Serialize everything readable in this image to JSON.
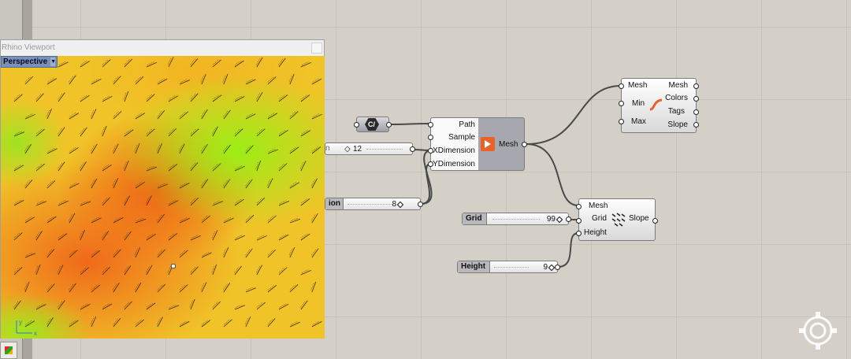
{
  "viewport": {
    "title": "Rhino Viewport",
    "view_mode": "Perspective",
    "axis_labels": {
      "y": "y",
      "x": "x"
    }
  },
  "canvas": {
    "cluster_label": "C/",
    "path_component": {
      "inputs": [
        "Path",
        "Sample",
        "XDimension",
        "YDimension"
      ],
      "output": "Mesh"
    },
    "analysis_component": {
      "inputs": [
        "Mesh",
        "Min",
        "Max"
      ],
      "outputs": [
        "Mesh",
        "Colors",
        "Tags",
        "Slope"
      ]
    },
    "slope_component": {
      "inputs": [
        "Mesh",
        "Grid",
        "Height"
      ],
      "output": "Slope"
    },
    "sliders": [
      {
        "label": "n",
        "value": "12",
        "marker": "◇"
      },
      {
        "label": "ion",
        "value": "8"
      },
      {
        "label": "Grid",
        "value": "99"
      },
      {
        "label": "Height",
        "value": "9"
      }
    ]
  },
  "colors": {
    "canvas_bg": "#d4d0c8",
    "heat_high": "#f05a14",
    "heat_mid": "#f0c428",
    "heat_low": "#96f014",
    "accent_orange": "#e8622a"
  }
}
